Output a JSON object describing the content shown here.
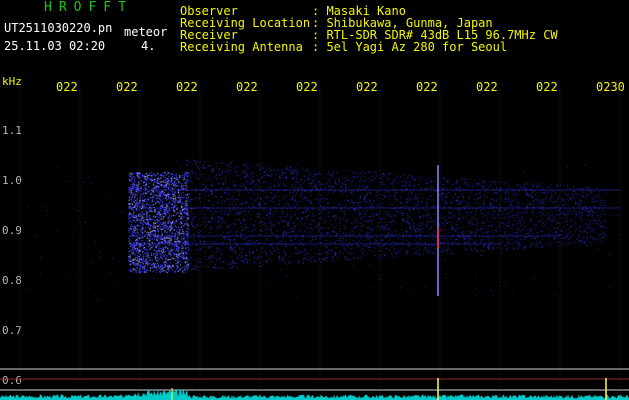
{
  "header": {
    "title": "HROFFT",
    "filename": "UT2511030220.pn",
    "event_type": "meteor",
    "datetime": "25.11.03 02:20",
    "count": "4.",
    "labels": [
      {
        "key": "Observer",
        "value": ": Masaki Kano"
      },
      {
        "key": "Receiving Location",
        "value": ": Shibukawa, Gunma, Japan"
      },
      {
        "key": "Receiver",
        "value": ": RTL-SDR SDR# 43dB L15 96.7MHz CW"
      },
      {
        "key": "Receiving Antenna",
        "value": ": 5el Yagi Az 280 for Seoul"
      }
    ]
  },
  "axis": {
    "unit": "kHz",
    "time_ticks": [
      "022",
      "022",
      "022",
      "022",
      "022",
      "022",
      "022",
      "022",
      "022",
      "0230"
    ],
    "freq_ticks": [
      "1.1",
      "1.0",
      "0.9",
      "0.8",
      "0.7",
      "0.6"
    ]
  },
  "colors": {
    "background": "#000000",
    "text_yellow": "#f5f500",
    "title_green": "#18c418",
    "signal_blue": "#3a3aff",
    "signal_bright": "#a0a0ff",
    "trace_cyan": "#00e0e0",
    "red_mark": "#ff3030"
  }
}
